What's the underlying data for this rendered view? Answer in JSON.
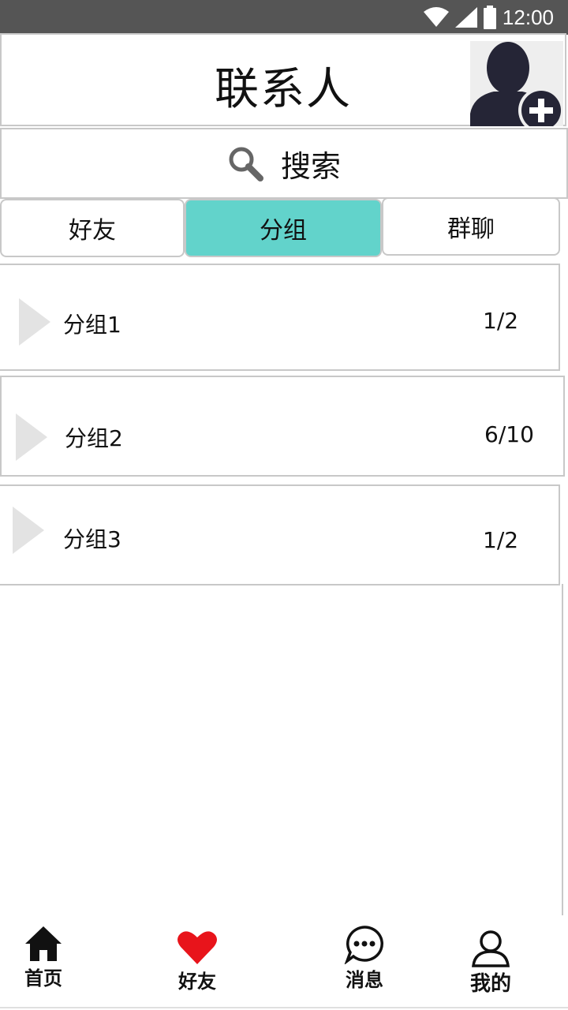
{
  "status_bar": {
    "time": "12:00",
    "icons": [
      "wifi-icon",
      "signal-icon",
      "battery-icon"
    ]
  },
  "header": {
    "title": "联系人",
    "add_contact_icon": "add-contact-icon"
  },
  "search": {
    "label": "搜索",
    "icon": "search-icon"
  },
  "tabs": [
    {
      "label": "好友",
      "active": false
    },
    {
      "label": "分组",
      "active": true
    },
    {
      "label": "群聊",
      "active": false
    }
  ],
  "groups": [
    {
      "name": "分组1",
      "count": "1/2"
    },
    {
      "name": "分组2",
      "count": "6/10"
    },
    {
      "name": "分组3",
      "count": "1/2"
    }
  ],
  "bottom_nav": [
    {
      "label": "首页",
      "icon": "home-icon"
    },
    {
      "label": "好友",
      "icon": "heart-icon"
    },
    {
      "label": "消息",
      "icon": "message-icon"
    },
    {
      "label": "我的",
      "icon": "user-icon"
    }
  ],
  "colors": {
    "status_bar": "#555555",
    "active_tab": "#62d3cb",
    "heart": "#e8141b",
    "border": "#c8c8c8"
  }
}
